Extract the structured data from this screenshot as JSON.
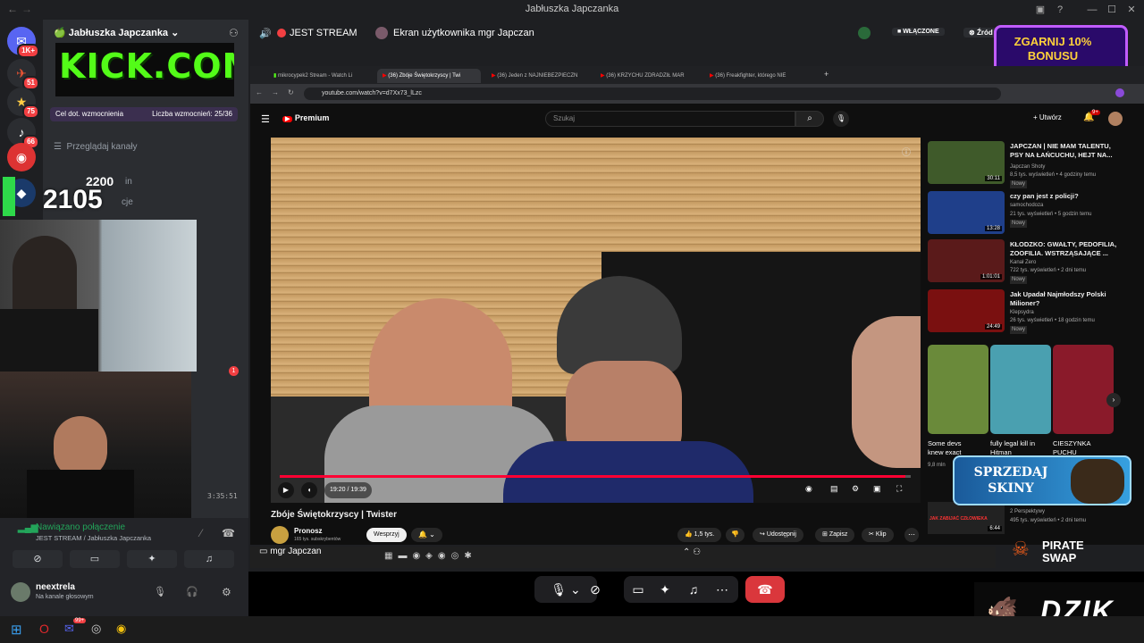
{
  "window": {
    "title": "Jabłuszka Japczanka",
    "min": "—",
    "max": "☐",
    "close": "✕"
  },
  "server_badges": [
    "1K+",
    "51",
    "75",
    "66"
  ],
  "channel": {
    "server_name": "Jabłuszka Japczanka",
    "logo_text": "KICK.COM",
    "boost_goal": "Cel dot. wzmocnienia",
    "boost_count": "Liczba wzmocnień: 25/36",
    "browse": "Przeglądaj kanały",
    "item_in": "in",
    "item_cje": "cje",
    "overlay_small": "2200",
    "overlay_big": "2105",
    "timestamp": "3:35:51",
    "notif": "1",
    "voice_status": "Nawiązano połączenie",
    "voice_channel": "JEST STREAM / Jabłuszka Japczanka",
    "user_name": "neextrela",
    "user_status": "Na kanale głosowym"
  },
  "voice_header": {
    "channel": "JEST STREAM",
    "screen": "Ekran użytkownika mgr Japczan",
    "live": "WŁĄCZONE",
    "source": "Źród"
  },
  "browser": {
    "tabs": [
      "mikrocypek2 Stream - Watch Li",
      "(36) Zbóje Świętokrzyscy | Twi",
      "(36) Jeden z NAJNIEBEZPIECZN",
      "(36) KRZYCHU ZDRADZIŁ MAR",
      "(36) Freakfighter, którego NIE"
    ],
    "url": "youtube.com/watch?v=d7Xx73_lLzc"
  },
  "youtube": {
    "logo": "Premium",
    "search_placeholder": "Szukaj",
    "create": "Utwórz",
    "notif": "9+",
    "time": "19:20 / 19:39",
    "title": "Zbóje Świętokrzyscy | Twister",
    "channel": "Pronosz",
    "subs": "165 tys. subskrybentów",
    "support": "Wesprzyj",
    "likes": "1,5 tys.",
    "share": "Udostępnij",
    "save": "Zapisz",
    "clip": "Klip"
  },
  "recommendations": [
    {
      "title": "JAPCZAN | NIE MAM TALENTU, PSY NA ŁAŃCUCHU, HEJT NA...",
      "channel": "Japczan Shoty",
      "meta": "8,5 tys. wyświetleń • 4 godziny temu",
      "badge": "Nowy",
      "dur": "30:11",
      "color": "#3f5a2a"
    },
    {
      "title": "czy pan jest z policji?",
      "channel": "samochodoza",
      "meta": "21 tys. wyświetleń • 5 godzin temu",
      "badge": "Nowy",
      "dur": "13:28",
      "color": "#1f3f8a"
    },
    {
      "title": "KŁODZKO: GWAŁTY, PEDOFILIA, ZOOFILIA. WSTRZĄSAJĄCE ...",
      "channel": "Kanał Zero",
      "meta": "722 tys. wyświetleń • 2 dni temu",
      "badge": "Nowy",
      "dur": "1:01:01",
      "color": "#5a1a1a"
    },
    {
      "title": "Jak Upadał Najmłodszy Polski Milioner?",
      "channel": "Klepsydra",
      "meta": "26 tys. wyświetleń • 18 godzin temu",
      "badge": "Nowy",
      "dur": "24:49",
      "color": "#7a1010"
    }
  ],
  "shorts": [
    {
      "title": "Some devs knew exact",
      "meta": "9,8 mln",
      "color": "#6a8a3a"
    },
    {
      "title": "fully legal kill in Hitman",
      "meta": "",
      "color": "#4aa0b0"
    },
    {
      "title": "CIESZYNKA PUCHU",
      "meta": "",
      "color": "#8a1a2a"
    }
  ],
  "below": {
    "meta": "2 Perspektywy",
    "meta2": "495 tys. wyświetleń • 2 dni temu",
    "dur": "6:44",
    "thumb_text": "JAK ZABIJAĆ CZŁOWIEKA"
  },
  "share_user": "mgr Japczan",
  "promos": {
    "bonus": "ZGARNIJ 10% BONUSU",
    "skins": "SPRZEDAJ SKINY",
    "pirate": "PIRATE SWAP",
    "dzik": "DZIK"
  },
  "taskbar_badge": "99+"
}
